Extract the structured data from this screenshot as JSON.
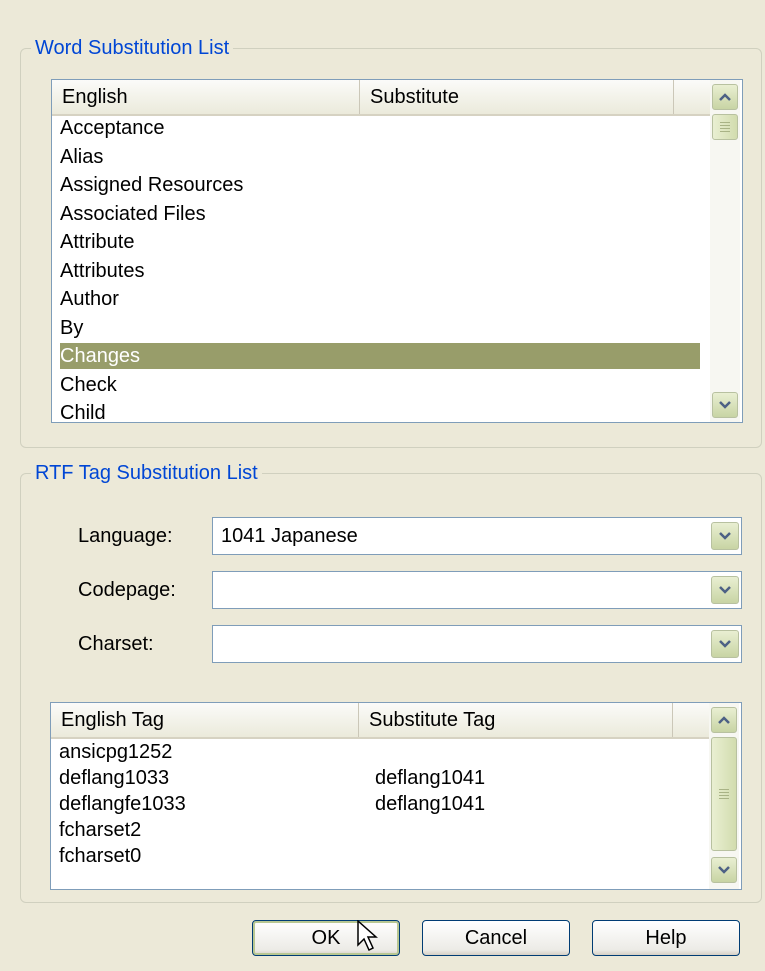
{
  "word_group": {
    "title": "Word Substitution List",
    "columns": [
      "English",
      "Substitute"
    ],
    "rows": [
      {
        "english": "Acceptance",
        "substitute": ""
      },
      {
        "english": "Alias",
        "substitute": ""
      },
      {
        "english": "Assigned Resources",
        "substitute": ""
      },
      {
        "english": "Associated Files",
        "substitute": ""
      },
      {
        "english": "Attribute",
        "substitute": ""
      },
      {
        "english": "Attributes",
        "substitute": ""
      },
      {
        "english": "Author",
        "substitute": ""
      },
      {
        "english": "By",
        "substitute": ""
      },
      {
        "english": "Changes",
        "substitute": "",
        "selected": true
      },
      {
        "english": "Check",
        "substitute": ""
      },
      {
        "english": "Child",
        "substitute": ""
      }
    ]
  },
  "rtf_group": {
    "title": "RTF Tag Substitution List",
    "language": {
      "label": "Language:",
      "value": "1041 Japanese"
    },
    "codepage": {
      "label": "Codepage:",
      "value": ""
    },
    "charset": {
      "label": "Charset:",
      "value": ""
    },
    "columns": [
      "English Tag",
      "Substitute Tag"
    ],
    "rows": [
      {
        "english": "ansicpg1252",
        "substitute": ""
      },
      {
        "english": "deflang1033",
        "substitute": "deflang1041"
      },
      {
        "english": "deflangfe1033",
        "substitute": "deflang1041"
      },
      {
        "english": "fcharset2",
        "substitute": ""
      },
      {
        "english": "fcharset0",
        "substitute": ""
      }
    ]
  },
  "buttons": {
    "ok": "OK",
    "cancel": "Cancel",
    "help": "Help"
  },
  "icons": {
    "scroll_up": "chevron-up-icon",
    "scroll_down": "chevron-down-icon",
    "combo_drop": "chevron-down-icon",
    "cursor": "mouse-pointer-icon"
  },
  "colors": {
    "group_title": "#0046d5",
    "selection": "#989d6a",
    "dialog_bg": "#ece9d8"
  }
}
